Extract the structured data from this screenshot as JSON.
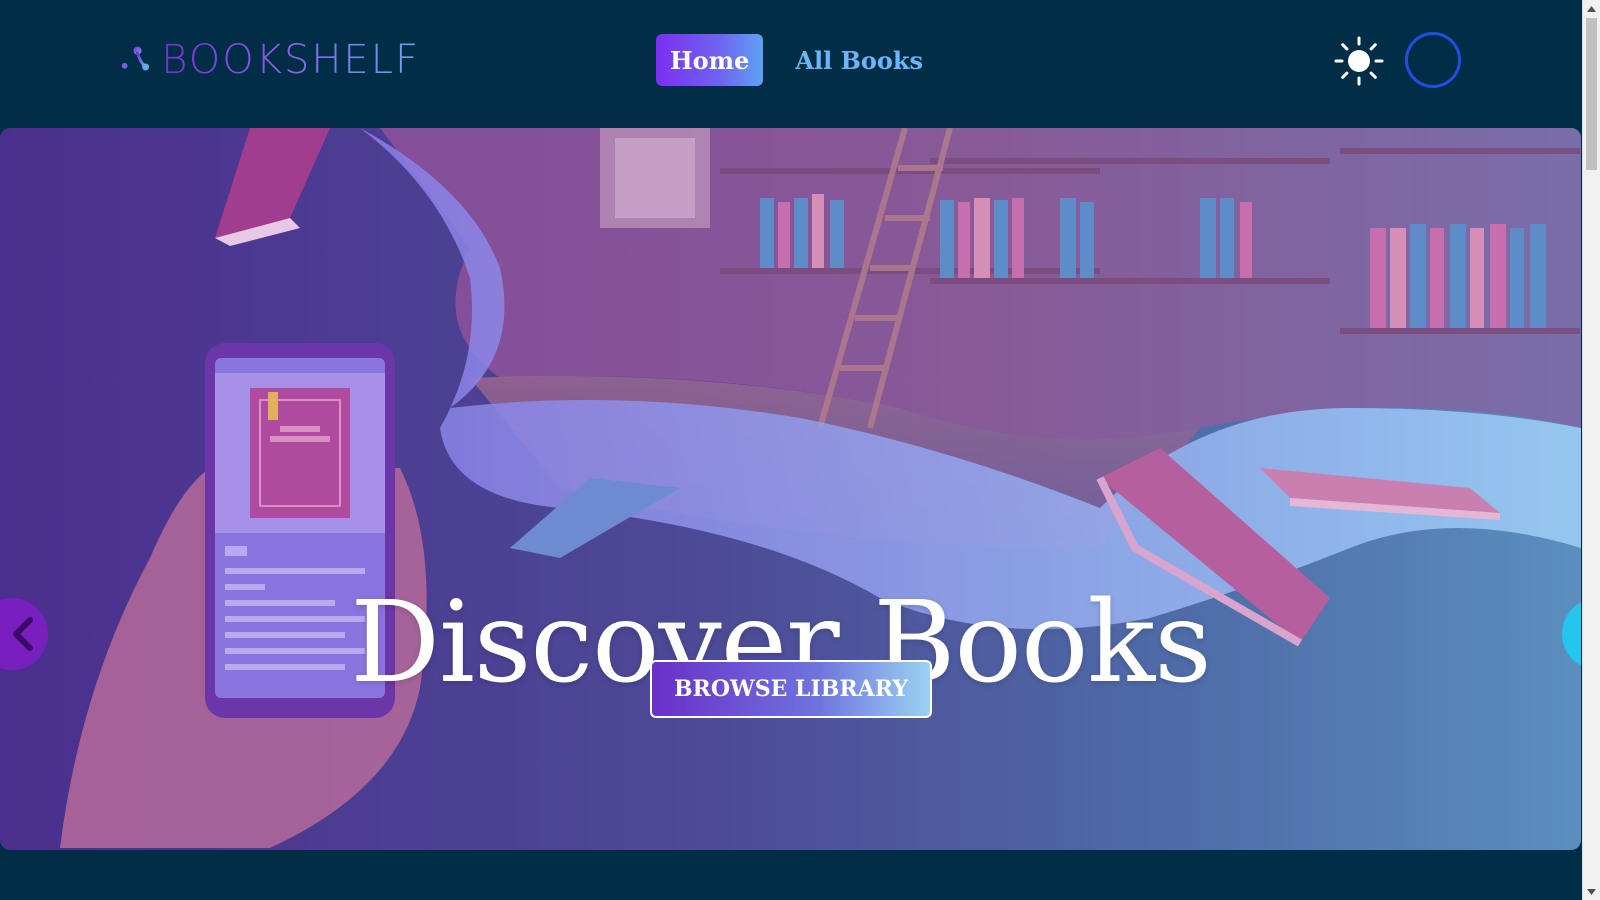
{
  "app": {
    "logo_text": "BOOKSHELF"
  },
  "nav": {
    "home_label": "Home",
    "all_books_label": "All Books"
  },
  "header": {
    "theme_toggle_icon": "sun-icon",
    "avatar_icon": "user-avatar"
  },
  "hero": {
    "title": "Discover Books",
    "cta_label": "BROWSE LIBRARY",
    "prev_icon": "chevron-left-icon",
    "next_icon": "chevron-right-icon"
  },
  "colors": {
    "background": "#022d47",
    "accent_purple": "#7b2ff0",
    "accent_blue": "#6cb6f5",
    "prev_button": "#7a1fbf",
    "next_button": "#22c6ee"
  }
}
